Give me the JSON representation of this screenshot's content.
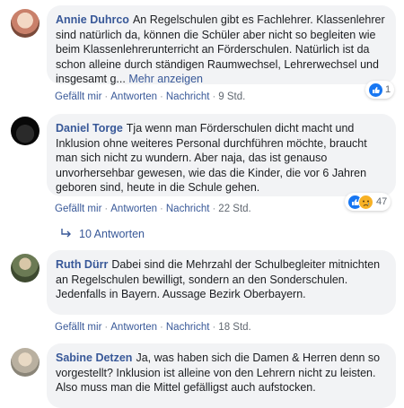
{
  "comments": [
    {
      "author": "Annie Duhrco",
      "text": "An Regelschulen gibt es Fachlehrer. Klassenlehrer sind natürlich da, können die Schüler aber nicht so begleiten wie beim Klassenlehrerunterricht an Förderschulen. Natürlich ist da schon alleine durch ständigen Raumwechsel, Lehrerwechsel und insgesamt g...",
      "more": "Mehr anzeigen",
      "actions": {
        "like": "Gefällt mir",
        "reply": "Antworten",
        "message": "Nachricht",
        "time": "9 Std."
      },
      "reactions": {
        "count": "1",
        "icons": [
          "like-icon"
        ]
      }
    },
    {
      "author": "Daniel Torge",
      "text": "Tja wenn man Förderschulen dicht macht und Inklusion ohne weiteres Personal durchführen möchte, braucht man sich nicht zu wundern. Aber naja, das ist genauso unvorhersehbar gewesen, wie das die Kinder, die vor 6 Jahren geboren sind, heute in die Schule gehen.",
      "actions": {
        "like": "Gefällt mir",
        "reply": "Antworten",
        "message": "Nachricht",
        "time": "22 Std."
      },
      "reactions": {
        "count": "47",
        "icons": [
          "like-icon",
          "sad-icon"
        ]
      },
      "replies": "10 Antworten"
    },
    {
      "author": "Ruth Dürr",
      "text": "Dabei sind die Mehrzahl der Schulbegleiter mitnichten an Regelschulen bewilligt, sondern an den Sonderschulen. Jedenfalls in Bayern. Aussage Bezirk Oberbayern.",
      "actions": {
        "like": "Gefällt mir",
        "reply": "Antworten",
        "message": "Nachricht",
        "time": "18 Std."
      }
    },
    {
      "author": "Sabine Detzen",
      "text": "Ja, was haben sich die Damen & Herren denn so vorgestellt? Inklusion ist alleine von den Lehrern nicht zu leisten. Also muss man die Mittel gefälligst auch aufstocken."
    }
  ],
  "colors": {
    "link": "#385898",
    "bubble": "#f2f3f5",
    "like": "#1877f2",
    "sad": "#f7b125"
  }
}
